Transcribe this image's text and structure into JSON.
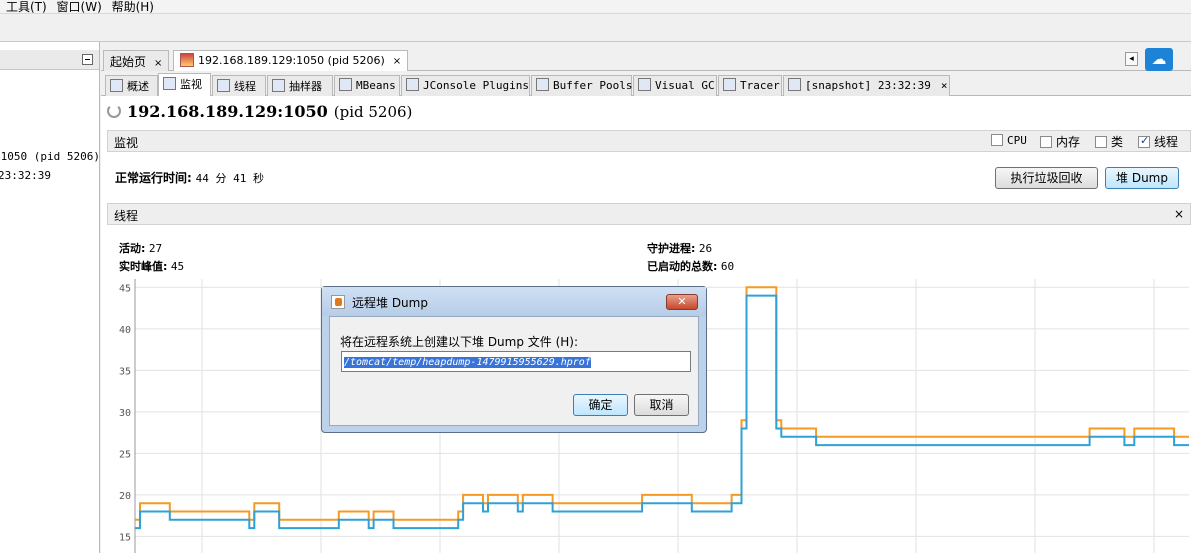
{
  "menubar": {
    "items": [
      "工具(T)",
      "窗口(W)",
      "帮助(H)"
    ]
  },
  "left_pane": {
    "rows": [
      ":1050 (pid 5206)",
      "23:32:39"
    ]
  },
  "doc_tabs": [
    {
      "label": "起始页",
      "close": "×"
    },
    {
      "label": "192.168.189.129:1050 (pid 5206)",
      "close": "×"
    }
  ],
  "right_ctl": {
    "arrow": "◂",
    "cloud_icon": "cloud-icon"
  },
  "sub_tabs": [
    {
      "label": "概述"
    },
    {
      "label": "监视"
    },
    {
      "label": "线程"
    },
    {
      "label": "抽样器"
    },
    {
      "label": "MBeans"
    },
    {
      "label": "JConsole Plugins"
    },
    {
      "label": "Buffer Pools"
    },
    {
      "label": "Visual GC"
    },
    {
      "label": "Tracer"
    },
    {
      "label": "[snapshot] 23:32:39",
      "close": "×"
    }
  ],
  "header": {
    "host": "192.168.189.129:1050",
    "pid": "(pid 5206)"
  },
  "monitor": {
    "title": "监视",
    "checkboxes": [
      {
        "label": "CPU",
        "checked": false
      },
      {
        "label": "内存",
        "checked": false
      },
      {
        "label": "类",
        "checked": false
      },
      {
        "label": "线程",
        "checked": true
      }
    ],
    "uptime_label": "正常运行时间:",
    "uptime_value": "44 分 41 秒",
    "gc_button": "执行垃圾回收",
    "heap_button": "堆 Dump"
  },
  "threads": {
    "title": "线程",
    "close": "×",
    "live_label": "活动:",
    "live_value": "27",
    "peak_label": "实时峰值:",
    "peak_value": "45",
    "daemon_label": "守护进程:",
    "daemon_value": "26",
    "started_label": "已启动的总数:",
    "started_value": "60"
  },
  "chart_data": {
    "type": "line",
    "y_ticks": [
      "45",
      "40",
      "35",
      "30",
      "25",
      "20",
      "15"
    ],
    "ylim": [
      13,
      46
    ],
    "grid": true,
    "series": [
      {
        "color": "#f59a23",
        "values": [
          17,
          19,
          19,
          19,
          19,
          19,
          19,
          18,
          18,
          18,
          18,
          18,
          18,
          18,
          18,
          18,
          18,
          18,
          18,
          18,
          18,
          18,
          18,
          17,
          19,
          19,
          19,
          19,
          19,
          17,
          17,
          17,
          17,
          17,
          17,
          17,
          17,
          17,
          17,
          17,
          17,
          18,
          18,
          18,
          18,
          18,
          18,
          17,
          18,
          18,
          18,
          18,
          17,
          17,
          17,
          17,
          17,
          17,
          17,
          17,
          17,
          17,
          17,
          17,
          17,
          18,
          20,
          20,
          20,
          20,
          19,
          20,
          20,
          20,
          20,
          20,
          20,
          19,
          20,
          20,
          20,
          20,
          20,
          20,
          19,
          19,
          19,
          19,
          19,
          19,
          19,
          19,
          19,
          19,
          19,
          19,
          19,
          19,
          19,
          19,
          19,
          19,
          20,
          20,
          20,
          20,
          20,
          20,
          20,
          20,
          20,
          20,
          19,
          19,
          19,
          19,
          19,
          19,
          19,
          19,
          20,
          20,
          29,
          45,
          45,
          45,
          45,
          45,
          45,
          29,
          28,
          28,
          28,
          28,
          28,
          28,
          28,
          27,
          27,
          27,
          27,
          27,
          27,
          27,
          27,
          27,
          27,
          27,
          27,
          27,
          27,
          27,
          27,
          27,
          27,
          27,
          27,
          27,
          27,
          27,
          27,
          27,
          27,
          27,
          27,
          27,
          27,
          27,
          27,
          27,
          27,
          27,
          27,
          27,
          27,
          27,
          27,
          27,
          27,
          27,
          27,
          27,
          27,
          27,
          27,
          27,
          27,
          27,
          27,
          27,
          27,
          27,
          28,
          28,
          28,
          28,
          28,
          28,
          28,
          27,
          27,
          28,
          28,
          28,
          28,
          28,
          28,
          28,
          28,
          27,
          27,
          27
        ]
      },
      {
        "color": "#2ea1d6",
        "values": [
          16,
          18,
          18,
          18,
          18,
          18,
          18,
          17,
          17,
          17,
          17,
          17,
          17,
          17,
          17,
          17,
          17,
          17,
          17,
          17,
          17,
          17,
          17,
          16,
          18,
          18,
          18,
          18,
          18,
          16,
          16,
          16,
          16,
          16,
          16,
          16,
          16,
          16,
          16,
          16,
          16,
          17,
          17,
          17,
          17,
          17,
          17,
          16,
          17,
          17,
          17,
          17,
          16,
          16,
          16,
          16,
          16,
          16,
          16,
          16,
          16,
          16,
          16,
          16,
          16,
          17,
          19,
          19,
          19,
          19,
          18,
          19,
          19,
          19,
          19,
          19,
          19,
          18,
          19,
          19,
          19,
          19,
          19,
          19,
          18,
          18,
          18,
          18,
          18,
          18,
          18,
          18,
          18,
          18,
          18,
          18,
          18,
          18,
          18,
          18,
          18,
          18,
          19,
          19,
          19,
          19,
          19,
          19,
          19,
          19,
          19,
          19,
          18,
          18,
          18,
          18,
          18,
          18,
          18,
          18,
          19,
          19,
          28,
          44,
          44,
          44,
          44,
          44,
          44,
          28,
          27,
          27,
          27,
          27,
          27,
          27,
          27,
          26,
          26,
          26,
          26,
          26,
          26,
          26,
          26,
          26,
          26,
          26,
          26,
          26,
          26,
          26,
          26,
          26,
          26,
          26,
          26,
          26,
          26,
          26,
          26,
          26,
          26,
          26,
          26,
          26,
          26,
          26,
          26,
          26,
          26,
          26,
          26,
          26,
          26,
          26,
          26,
          26,
          26,
          26,
          26,
          26,
          26,
          26,
          26,
          26,
          26,
          26,
          26,
          26,
          26,
          26,
          27,
          27,
          27,
          27,
          27,
          27,
          27,
          26,
          26,
          27,
          27,
          27,
          27,
          27,
          27,
          27,
          27,
          26,
          26,
          26
        ]
      }
    ]
  },
  "dialog": {
    "title": "远程堆 Dump",
    "close": "✕",
    "prompt": "将在远程系统上创建以下堆 Dump 文件 (H):",
    "path": "/tomcat/temp/heapdump-1479915955629.hprof",
    "ok": "确定",
    "cancel": "取消"
  }
}
